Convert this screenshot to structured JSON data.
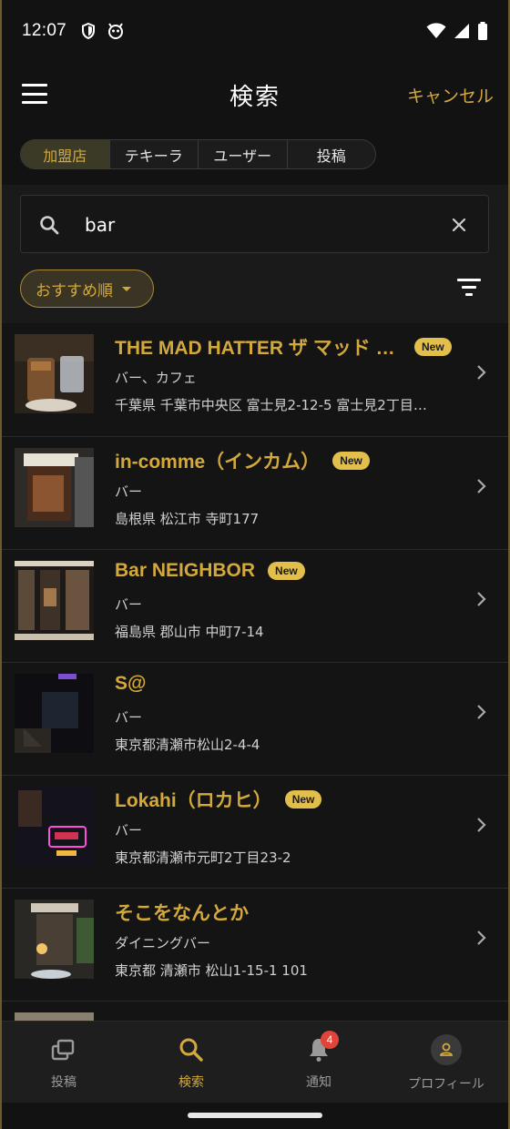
{
  "status_bar": {
    "time": "12:07"
  },
  "header": {
    "title": "検索",
    "cancel_label": "キャンセル"
  },
  "tabs": [
    {
      "label": "加盟店",
      "active": true
    },
    {
      "label": "テキーラ",
      "active": false
    },
    {
      "label": "ユーザー",
      "active": false
    },
    {
      "label": "投稿",
      "active": false
    }
  ],
  "search": {
    "value": "bar"
  },
  "sort": {
    "label": "おすすめ順"
  },
  "badge_label": "New",
  "results": [
    {
      "name": "THE MAD HATTER ザ マッド …",
      "category": "バー、カフェ",
      "address": "千葉県 千葉市中央区 富士見2-12-5 富士見2丁目…",
      "is_new": true
    },
    {
      "name": "in-comme（インカム）",
      "category": "バー",
      "address": "島根県 松江市 寺町177",
      "is_new": true
    },
    {
      "name": "Bar NEIGHBOR",
      "category": "バー",
      "address": "福島県 郡山市 中町7-14",
      "is_new": true
    },
    {
      "name": "S@",
      "category": "バー",
      "address": "東京都清瀬市松山2-4-4",
      "is_new": false
    },
    {
      "name": "Lokahi（ロカヒ）",
      "category": "バー",
      "address": "東京都清瀬市元町2丁目23-2",
      "is_new": true
    },
    {
      "name": "そこをなんとか",
      "category": "ダイニングバー",
      "address": "東京都 清瀬市 松山1-15-1 101",
      "is_new": false
    }
  ],
  "bottom_nav": [
    {
      "label": "投稿",
      "icon": "posts-icon",
      "active": false
    },
    {
      "label": "検索",
      "icon": "search-icon",
      "active": true
    },
    {
      "label": "通知",
      "icon": "bell-icon",
      "active": false,
      "badge": "4"
    },
    {
      "label": "プロフィール",
      "icon": "person-icon",
      "active": false
    }
  ],
  "colors": {
    "accent": "#d4a93b",
    "badge_bg": "#e2bf4a",
    "notification": "#e0453a"
  }
}
